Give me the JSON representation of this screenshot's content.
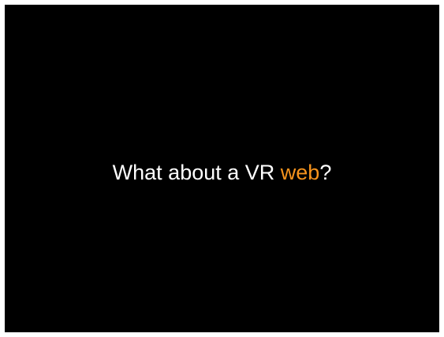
{
  "slide": {
    "heading": {
      "before": "What about a VR ",
      "highlight": "web",
      "after": "?"
    }
  },
  "colors": {
    "background": "#000000",
    "text": "#ffffff",
    "accent": "#f7941d",
    "page": "#ffffff"
  }
}
